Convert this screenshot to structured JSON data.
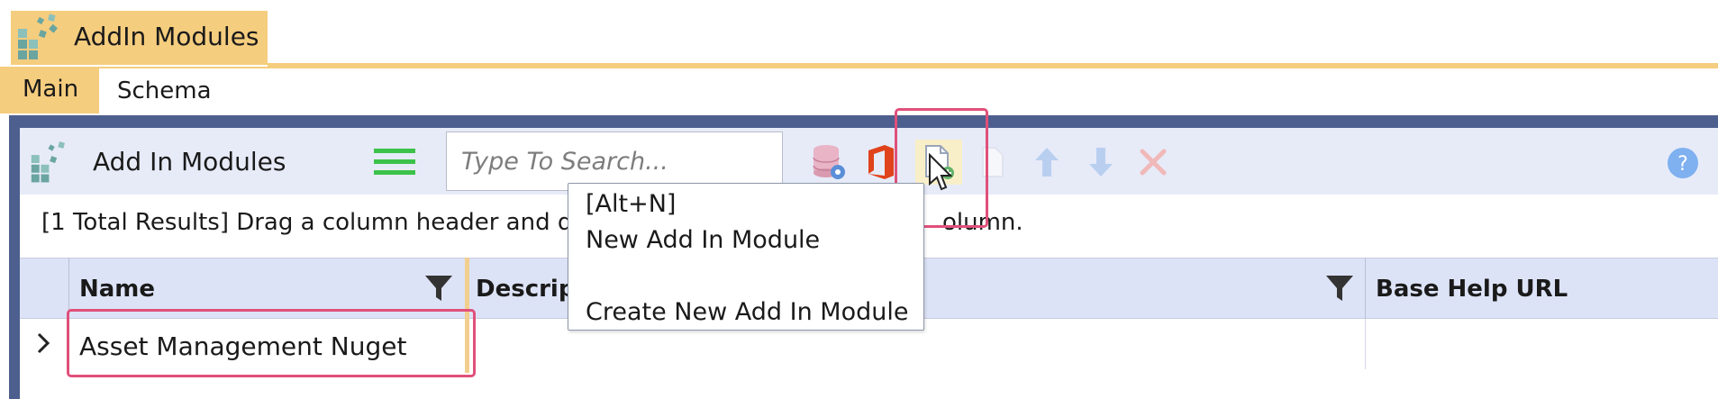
{
  "window": {
    "title": "AddIn Modules",
    "app_icon": "modules-icon"
  },
  "ribbon": {
    "tabs": [
      {
        "label": "Main",
        "active": true
      },
      {
        "label": "Schema",
        "active": false
      }
    ]
  },
  "toolbar": {
    "title": "Add In Modules",
    "title_icon": "modules-icon",
    "menu_icon": "hamburger-icon",
    "search": {
      "placeholder": "Type To Search...",
      "value": ""
    },
    "buttons": [
      {
        "name": "database-settings-icon"
      },
      {
        "name": "office-icon"
      },
      {
        "name": "new-document-icon",
        "hovered": true
      },
      {
        "name": "copy-document-icon",
        "disabled": true
      },
      {
        "name": "move-up-icon",
        "disabled": true
      },
      {
        "name": "move-down-icon",
        "disabled": true
      },
      {
        "name": "delete-icon",
        "disabled": true
      },
      {
        "name": "help-icon"
      }
    ]
  },
  "info_bar": {
    "text": "[1 Total Results] Drag a column header and d",
    "text_tail": "olumn."
  },
  "grid": {
    "columns": [
      {
        "label": "Name"
      },
      {
        "label": "Descript"
      },
      {
        "label": "Base Help URL"
      }
    ],
    "rows": [
      {
        "name": "Asset Management Nuget"
      }
    ]
  },
  "tooltip": {
    "shortcut": "[Alt+N]",
    "title": "New Add In Module",
    "description": "Create New Add In Module"
  },
  "colors": {
    "accent_gold": "#f5cd7e",
    "frame": "#4d5f8e",
    "toolbar_bg": "#e7ebf8",
    "highlight": "#e0507a"
  }
}
